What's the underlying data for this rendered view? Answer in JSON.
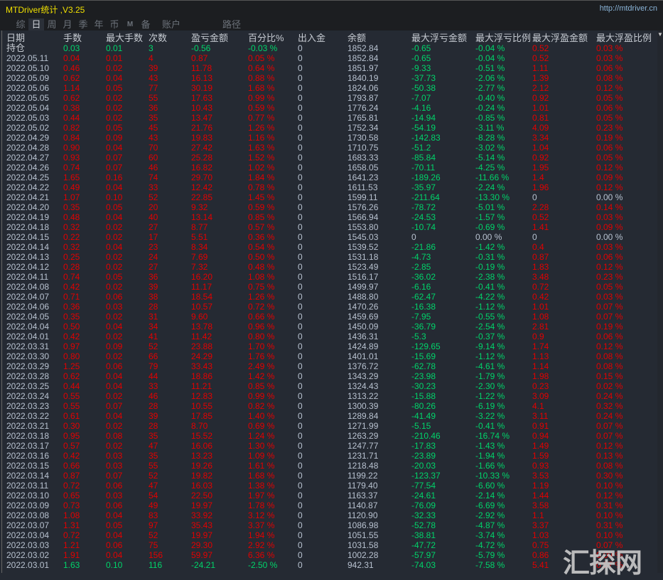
{
  "app": {
    "title": "MTDriver统计 ,V3.25",
    "url": "http://mtdriver.cn"
  },
  "tabs": [
    {
      "label": "综",
      "active": false
    },
    {
      "label": "日",
      "active": true
    },
    {
      "label": "周",
      "active": false
    },
    {
      "label": "月",
      "active": false
    },
    {
      "label": "季",
      "active": false
    },
    {
      "label": "年",
      "active": false
    },
    {
      "label": "币",
      "active": false
    },
    {
      "label": "M",
      "active": false
    },
    {
      "label": "备",
      "active": false
    },
    {
      "label": "账户",
      "active": false
    },
    {
      "label": "路径",
      "active": false
    }
  ],
  "colors": {
    "profit": "#e40000",
    "loss": "#00d46a",
    "neutral": "#b8c2d0",
    "title": "#f0e000"
  },
  "table": {
    "columns": [
      "日期",
      "手数",
      "最大手数",
      "次数",
      "盈亏金额",
      "百分比%",
      "出入金",
      "余额",
      "最大浮亏金额",
      "最大浮亏比例",
      "最大浮盈金额",
      "最大浮盈比例"
    ],
    "position_row": [
      "持仓",
      "0.03",
      "0.01",
      "3",
      "-0.56",
      "-0.03 %",
      "0",
      "1852.84",
      "-0.65",
      "-0.04 %",
      "0.52",
      "0.03 %"
    ],
    "rows": [
      [
        "2022.05.11",
        "0.04",
        "0.01",
        "4",
        "0.87",
        "0.05 %",
        "0",
        "1852.84",
        "-0.65",
        "-0.04 %",
        "0.52",
        "0.03 %"
      ],
      [
        "2022.05.10",
        "0.46",
        "0.02",
        "39",
        "11.78",
        "0.64 %",
        "0",
        "1851.97",
        "-9.33",
        "-0.51 %",
        "1.11",
        "0.06 %"
      ],
      [
        "2022.05.09",
        "0.62",
        "0.04",
        "43",
        "16.13",
        "0.88 %",
        "0",
        "1840.19",
        "-37.73",
        "-2.06 %",
        "1.39",
        "0.08 %"
      ],
      [
        "2022.05.06",
        "1.14",
        "0.05",
        "77",
        "30.19",
        "1.68 %",
        "0",
        "1824.06",
        "-50.38",
        "-2.77 %",
        "2.12",
        "0.12 %"
      ],
      [
        "2022.05.05",
        "0.62",
        "0.02",
        "55",
        "17.63",
        "0.99 %",
        "0",
        "1793.87",
        "-7.07",
        "-0.40 %",
        "0.92",
        "0.05 %"
      ],
      [
        "2022.05.04",
        "0.38",
        "0.02",
        "36",
        "10.43",
        "0.59 %",
        "0",
        "1776.24",
        "-4.16",
        "-0.24 %",
        "1.01",
        "0.06 %"
      ],
      [
        "2022.05.03",
        "0.44",
        "0.02",
        "35",
        "13.47",
        "0.77 %",
        "0",
        "1765.81",
        "-14.94",
        "-0.85 %",
        "0.81",
        "0.05 %"
      ],
      [
        "2022.05.02",
        "0.82",
        "0.05",
        "45",
        "21.76",
        "1.26 %",
        "0",
        "1752.34",
        "-54.19",
        "-3.11 %",
        "4.09",
        "0.23 %"
      ],
      [
        "2022.04.29",
        "0.84",
        "0.09",
        "43",
        "19.83",
        "1.16 %",
        "0",
        "1730.58",
        "-142.83",
        "-8.28 %",
        "3.34",
        "0.19 %"
      ],
      [
        "2022.04.28",
        "0.90",
        "0.04",
        "70",
        "27.42",
        "1.63 %",
        "0",
        "1710.75",
        "-51.2",
        "-3.02 %",
        "1.04",
        "0.06 %"
      ],
      [
        "2022.04.27",
        "0.93",
        "0.07",
        "60",
        "25.28",
        "1.52 %",
        "0",
        "1683.33",
        "-85.84",
        "-5.14 %",
        "0.92",
        "0.05 %"
      ],
      [
        "2022.04.26",
        "0.74",
        "0.07",
        "46",
        "16.82",
        "1.02 %",
        "0",
        "1658.05",
        "-70.11",
        "-4.25 %",
        "1.95",
        "0.12 %"
      ],
      [
        "2022.04.25",
        "1.65",
        "0.16",
        "74",
        "29.70",
        "1.84 %",
        "0",
        "1641.23",
        "-189.26",
        "-11.66 %",
        "1.4",
        "0.09 %"
      ],
      [
        "2022.04.22",
        "0.49",
        "0.04",
        "33",
        "12.42",
        "0.78 %",
        "0",
        "1611.53",
        "-35.97",
        "-2.24 %",
        "1.96",
        "0.12 %"
      ],
      [
        "2022.04.21",
        "1.07",
        "0.10",
        "52",
        "22.85",
        "1.45 %",
        "0",
        "1599.11",
        "-211.64",
        "-13.30 %",
        "0",
        "0.00 %"
      ],
      [
        "2022.04.20",
        "0.35",
        "0.05",
        "20",
        "9.32",
        "0.59 %",
        "0",
        "1576.26",
        "-78.72",
        "-5.01 %",
        "2.28",
        "0.14 %"
      ],
      [
        "2022.04.19",
        "0.48",
        "0.04",
        "40",
        "13.14",
        "0.85 %",
        "0",
        "1566.94",
        "-24.53",
        "-1.57 %",
        "0.52",
        "0.03 %"
      ],
      [
        "2022.04.18",
        "0.32",
        "0.02",
        "27",
        "8.77",
        "0.57 %",
        "0",
        "1553.80",
        "-10.74",
        "-0.69 %",
        "1.41",
        "0.09 %"
      ],
      [
        "2022.04.15",
        "0.22",
        "0.02",
        "17",
        "5.51",
        "0.36 %",
        "0",
        "1545.03",
        "0",
        "0.00 %",
        "0",
        "0.00 %"
      ],
      [
        "2022.04.14",
        "0.32",
        "0.04",
        "23",
        "8.34",
        "0.54 %",
        "0",
        "1539.52",
        "-21.86",
        "-1.42 %",
        "0.4",
        "0.03 %"
      ],
      [
        "2022.04.13",
        "0.25",
        "0.02",
        "24",
        "7.69",
        "0.50 %",
        "0",
        "1531.18",
        "-4.73",
        "-0.31 %",
        "0.87",
        "0.06 %"
      ],
      [
        "2022.04.12",
        "0.28",
        "0.02",
        "27",
        "7.32",
        "0.48 %",
        "0",
        "1523.49",
        "-2.85",
        "-0.19 %",
        "1.83",
        "0.12 %"
      ],
      [
        "2022.04.11",
        "0.74",
        "0.05",
        "36",
        "16.20",
        "1.08 %",
        "0",
        "1516.17",
        "-36.02",
        "-2.38 %",
        "3.48",
        "0.23 %"
      ],
      [
        "2022.04.08",
        "0.42",
        "0.02",
        "39",
        "11.17",
        "0.75 %",
        "0",
        "1499.97",
        "-6.16",
        "-0.41 %",
        "0.72",
        "0.05 %"
      ],
      [
        "2022.04.07",
        "0.71",
        "0.06",
        "38",
        "18.54",
        "1.26 %",
        "0",
        "1488.80",
        "-62.47",
        "-4.22 %",
        "0.42",
        "0.03 %"
      ],
      [
        "2022.04.06",
        "0.36",
        "0.03",
        "28",
        "10.57",
        "0.72 %",
        "0",
        "1470.26",
        "-16.38",
        "-1.12 %",
        "1.01",
        "0.07 %"
      ],
      [
        "2022.04.05",
        "0.35",
        "0.02",
        "31",
        "9.60",
        "0.66 %",
        "0",
        "1459.69",
        "-7.95",
        "-0.55 %",
        "1.08",
        "0.07 %"
      ],
      [
        "2022.04.04",
        "0.50",
        "0.04",
        "34",
        "13.78",
        "0.96 %",
        "0",
        "1450.09",
        "-36.79",
        "-2.54 %",
        "2.81",
        "0.19 %"
      ],
      [
        "2022.04.01",
        "0.42",
        "0.02",
        "41",
        "11.42",
        "0.80 %",
        "0",
        "1436.31",
        "-5.3",
        "-0.37 %",
        "0.9",
        "0.06 %"
      ],
      [
        "2022.03.31",
        "0.97",
        "0.09",
        "52",
        "23.88",
        "1.70 %",
        "0",
        "1424.89",
        "-129.65",
        "-9.14 %",
        "1.74",
        "0.12 %"
      ],
      [
        "2022.03.30",
        "0.80",
        "0.02",
        "66",
        "24.29",
        "1.76 %",
        "0",
        "1401.01",
        "-15.69",
        "-1.12 %",
        "1.13",
        "0.08 %"
      ],
      [
        "2022.03.29",
        "1.25",
        "0.06",
        "79",
        "33.43",
        "2.49 %",
        "0",
        "1376.72",
        "-62.78",
        "-4.61 %",
        "1.14",
        "0.08 %"
      ],
      [
        "2022.03.28",
        "0.62",
        "0.04",
        "44",
        "18.86",
        "1.42 %",
        "0",
        "1343.29",
        "-23.98",
        "-1.79 %",
        "1.98",
        "0.15 %"
      ],
      [
        "2022.03.25",
        "0.44",
        "0.04",
        "33",
        "11.21",
        "0.85 %",
        "0",
        "1324.43",
        "-30.23",
        "-2.30 %",
        "0.23",
        "0.02 %"
      ],
      [
        "2022.03.24",
        "0.55",
        "0.02",
        "46",
        "12.83",
        "0.99 %",
        "0",
        "1313.22",
        "-15.88",
        "-1.22 %",
        "3.09",
        "0.24 %"
      ],
      [
        "2022.03.23",
        "0.55",
        "0.07",
        "28",
        "10.55",
        "0.82 %",
        "0",
        "1300.39",
        "-80.26",
        "-6.19 %",
        "4.1",
        "0.32 %"
      ],
      [
        "2022.03.22",
        "0.61",
        "0.04",
        "39",
        "17.85",
        "1.40 %",
        "0",
        "1289.84",
        "-41.49",
        "-3.22 %",
        "3.11",
        "0.24 %"
      ],
      [
        "2022.03.21",
        "0.30",
        "0.02",
        "28",
        "8.70",
        "0.69 %",
        "0",
        "1271.99",
        "-5.15",
        "-0.41 %",
        "0.91",
        "0.07 %"
      ],
      [
        "2022.03.18",
        "0.95",
        "0.08",
        "35",
        "15.52",
        "1.24 %",
        "0",
        "1263.29",
        "-210.46",
        "-16.74 %",
        "0.94",
        "0.07 %"
      ],
      [
        "2022.03.17",
        "0.57",
        "0.02",
        "47",
        "16.06",
        "1.30 %",
        "0",
        "1247.77",
        "-17.83",
        "-1.43 %",
        "1.49",
        "0.12 %"
      ],
      [
        "2022.03.16",
        "0.42",
        "0.03",
        "35",
        "13.23",
        "1.09 %",
        "0",
        "1231.71",
        "-23.89",
        "-1.94 %",
        "1.59",
        "0.13 %"
      ],
      [
        "2022.03.15",
        "0.66",
        "0.03",
        "55",
        "19.26",
        "1.61 %",
        "0",
        "1218.48",
        "-20.03",
        "-1.66 %",
        "0.93",
        "0.08 %"
      ],
      [
        "2022.03.14",
        "0.87",
        "0.07",
        "52",
        "19.82",
        "1.68 %",
        "0",
        "1199.22",
        "-123.37",
        "-10.33 %",
        "3.53",
        "0.30 %"
      ],
      [
        "2022.03.11",
        "0.72",
        "0.06",
        "47",
        "16.03",
        "1.38 %",
        "0",
        "1179.40",
        "-77.54",
        "-6.60 %",
        "1.19",
        "0.10 %"
      ],
      [
        "2022.03.10",
        "0.65",
        "0.03",
        "54",
        "22.50",
        "1.97 %",
        "0",
        "1163.37",
        "-24.61",
        "-2.14 %",
        "1.44",
        "0.12 %"
      ],
      [
        "2022.03.09",
        "0.73",
        "0.06",
        "49",
        "19.97",
        "1.78 %",
        "0",
        "1140.87",
        "-76.09",
        "-6.69 %",
        "3.58",
        "0.31 %"
      ],
      [
        "2022.03.08",
        "1.08",
        "0.04",
        "83",
        "33.92",
        "3.12 %",
        "0",
        "1120.90",
        "-32.33",
        "-2.92 %",
        "1.1",
        "0.10 %"
      ],
      [
        "2022.03.07",
        "1.31",
        "0.05",
        "97",
        "35.43",
        "3.37 %",
        "0",
        "1086.98",
        "-52.78",
        "-4.87 %",
        "3.37",
        "0.31 %"
      ],
      [
        "2022.03.04",
        "0.72",
        "0.04",
        "52",
        "19.97",
        "1.94 %",
        "0",
        "1051.55",
        "-38.81",
        "-3.74 %",
        "1.03",
        "0.10 %"
      ],
      [
        "2022.03.03",
        "1.21",
        "0.06",
        "75",
        "29.30",
        "2.92 %",
        "0",
        "1031.58",
        "-47.72",
        "-4.72 %",
        "0.75",
        "0.07 %"
      ],
      [
        "2022.03.02",
        "1.91",
        "0.04",
        "156",
        "59.97",
        "6.36 %",
        "0",
        "1002.28",
        "-57.97",
        "-5.79 %",
        "0.86",
        "0.09 %"
      ],
      [
        "2022.03.01",
        "1.63",
        "0.10",
        "116",
        "-24.21",
        "-2.50 %",
        "0",
        "942.31",
        "-74.03",
        "-7.58 %",
        "5.41",
        "0.57 %"
      ]
    ]
  },
  "watermark": "汇探网"
}
